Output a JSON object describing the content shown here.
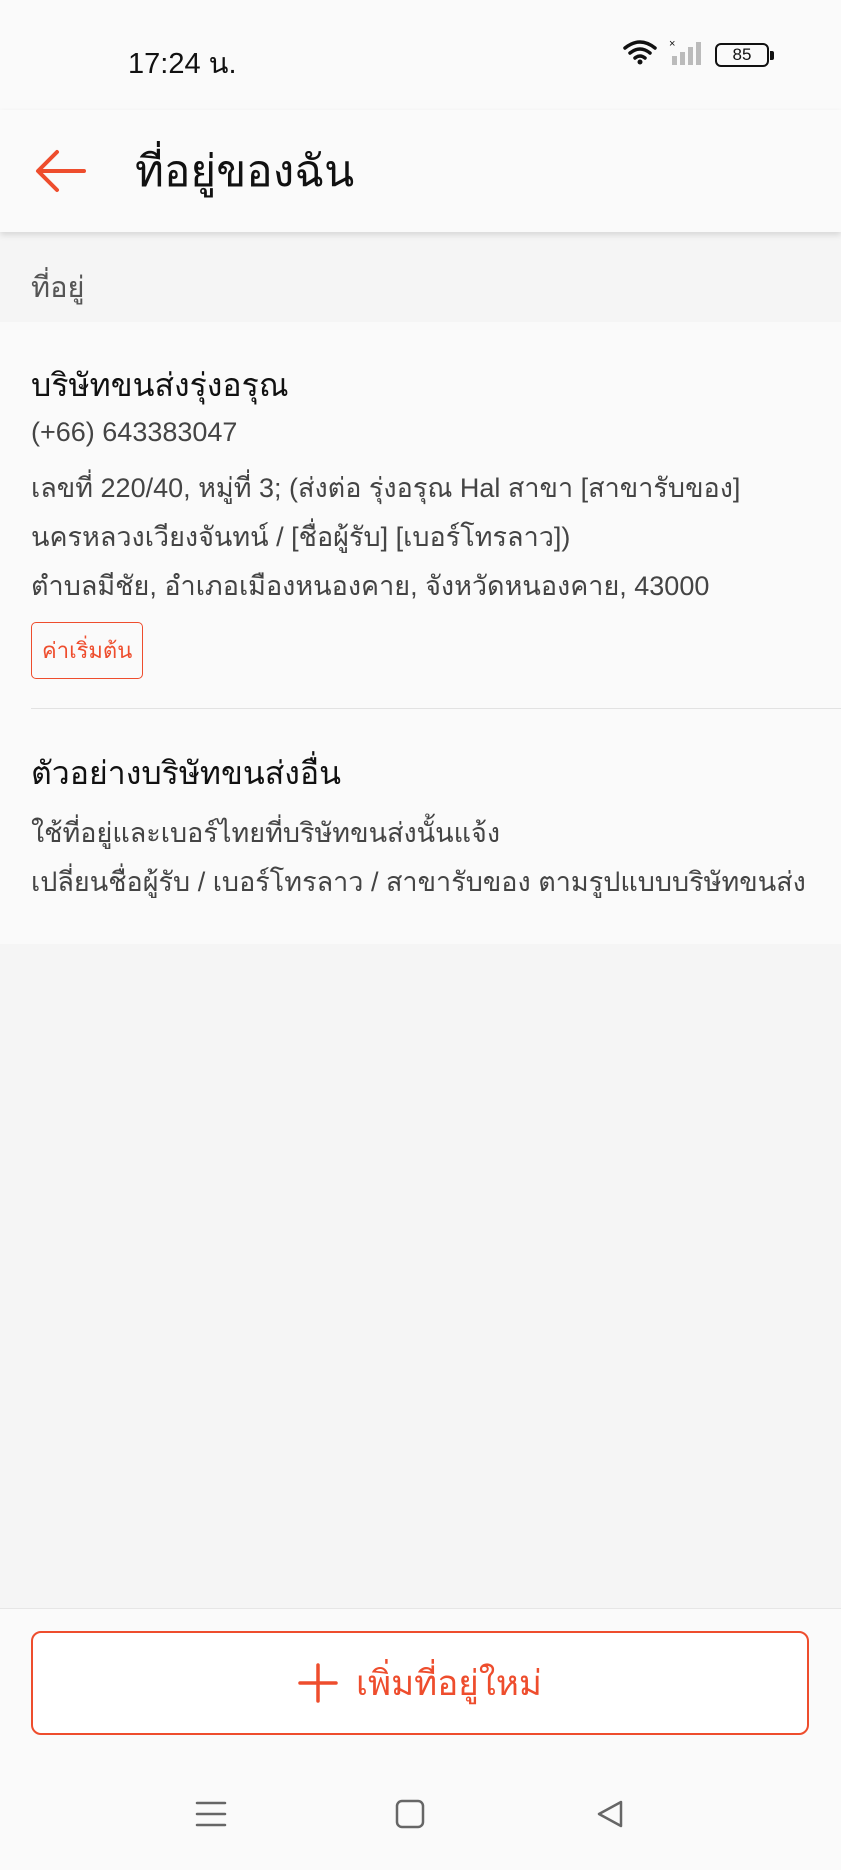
{
  "status_bar": {
    "time": "17:24 น.",
    "battery": "85",
    "icons": [
      "wifi-icon",
      "signal-icon",
      "battery-icon"
    ]
  },
  "header": {
    "title": "ที่อยู่ของฉัน",
    "back_icon": "arrow-left-icon"
  },
  "section": {
    "label": "ที่อยู่"
  },
  "address": {
    "name": "บริษัทขนส่งรุ่งอรุณ",
    "phone": "(+66) 643383047",
    "line1": "เลขที่ 220/40, หมู่ที่ 3;  (ส่งต่อ รุ่งอรุณ Hal สาขา [สาขารับของ]",
    "line2": "นครหลวงเวียงจันทน์ / [ชื่อผู้รับ] [เบอร์โทรลาว])",
    "line3": "ตำบลมีชัย, อำเภอเมืองหนองคาย, จังหวัดหนองคาย, 43000",
    "default_tag": "ค่าเริ่มต้น"
  },
  "example": {
    "title": "ตัวอย่างบริษัทขนส่งอื่น",
    "line1": "ใช้ที่อยู่และเบอร์ไทยที่บริษัทขนส่งนั้นแจ้ง",
    "line2": "เปลี่ยนชื่อผู้รับ / เบอร์โทรลาว / สาขารับของ ตามรูปแบบบริษัทขนส่ง"
  },
  "footer": {
    "add_button": "เพิ่มที่อยู่ใหม่",
    "add_icon": "plus-icon"
  },
  "nav": {
    "items": [
      "menu-icon",
      "home-square-icon",
      "back-triangle-icon"
    ]
  },
  "colors": {
    "accent": "#ee4d2d",
    "background": "#f5f5f5",
    "card": "#fafafa"
  }
}
